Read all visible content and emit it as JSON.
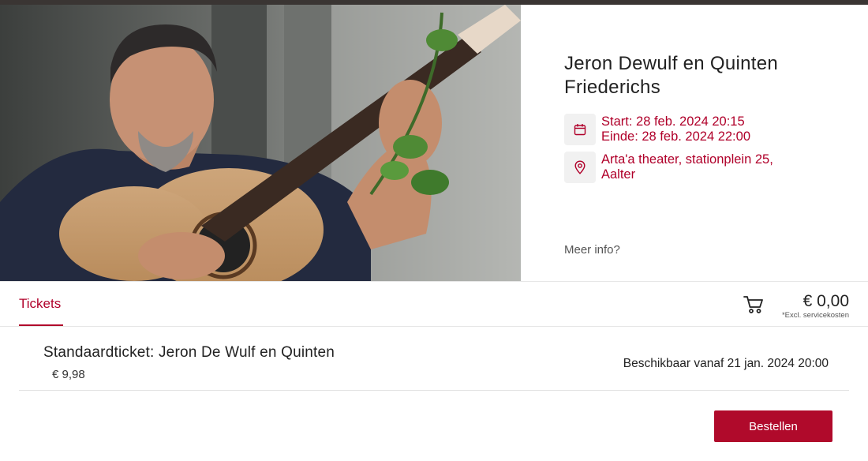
{
  "event": {
    "title": "Jeron Dewulf en Quinten Friederichs",
    "start": "Start: 28 feb. 2024 20:15",
    "end": "Einde: 28 feb. 2024 22:00",
    "location": "Arta'a theater, stationplein 25, Aalter",
    "more_info": "Meer info?",
    "image_icon": "photo-guitarist"
  },
  "tabs": {
    "tickets_label": "Tickets"
  },
  "cart": {
    "icon": "cart-icon",
    "total": "€ 0,00",
    "note": "*Excl. servicekosten"
  },
  "tickets": [
    {
      "name": "Standaardticket: Jeron De Wulf en Quinten",
      "price": "€ 9,98",
      "availability": "Beschikbaar vanaf 21 jan. 2024 20:00"
    }
  ],
  "actions": {
    "order_label": "Bestellen"
  },
  "colors": {
    "accent": "#b0002a",
    "button": "#b00a2b"
  }
}
